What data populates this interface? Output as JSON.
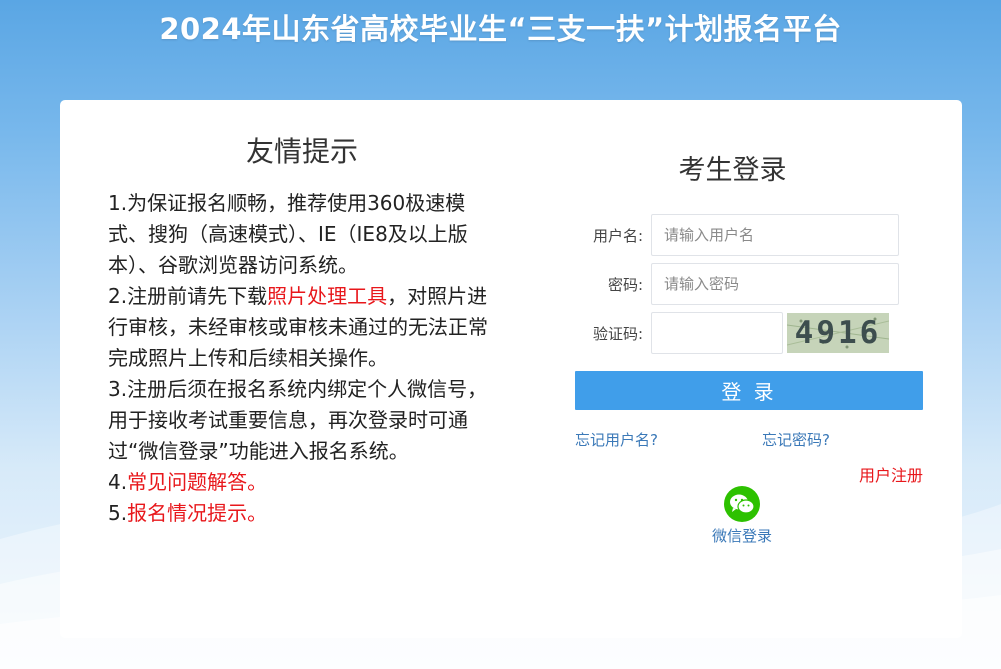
{
  "header": {
    "title": "2024年山东省高校毕业生“三支一扶”计划报名平台"
  },
  "tips": {
    "title": "友情提示",
    "item1": "1.为保证报名顺畅，推荐使用360极速模式、搜狗（高速模式）、IE（IE8及以上版本）、谷歌浏览器访问系统。",
    "item2_prefix": "2.注册前请先下载",
    "item2_link": "照片处理工具",
    "item2_suffix": "，对照片进行审核，未经审核或审核未通过的无法正常完成照片上传和后续相关操作。",
    "item3": "3.注册后须在报名系统内绑定个人微信号，用于接收考试重要信息，再次登录时可通过“微信登录”功能进入报名系统。",
    "item4_prefix": "4.",
    "item4_link": "常见问题解答。",
    "item5_prefix": "5.",
    "item5_link": "报名情况提示。"
  },
  "login": {
    "title": "考生登录",
    "username_label": "用户名:",
    "username_placeholder": "请输入用户名",
    "password_label": "密码:",
    "password_placeholder": "请输入密码",
    "captcha_label": "验证码:",
    "captcha_value": "",
    "captcha_text": "4916",
    "login_button": "登 录",
    "forgot_username": "忘记用户名?",
    "forgot_password": "忘记密码?",
    "register": "用户注册",
    "wechat_login": "微信登录"
  },
  "colors": {
    "accent_button": "#409eea",
    "link_blue": "#3b79b8",
    "link_red": "#e8171b",
    "wechat_green": "#2dc100"
  },
  "icons": {
    "wechat": "wechat-icon"
  }
}
